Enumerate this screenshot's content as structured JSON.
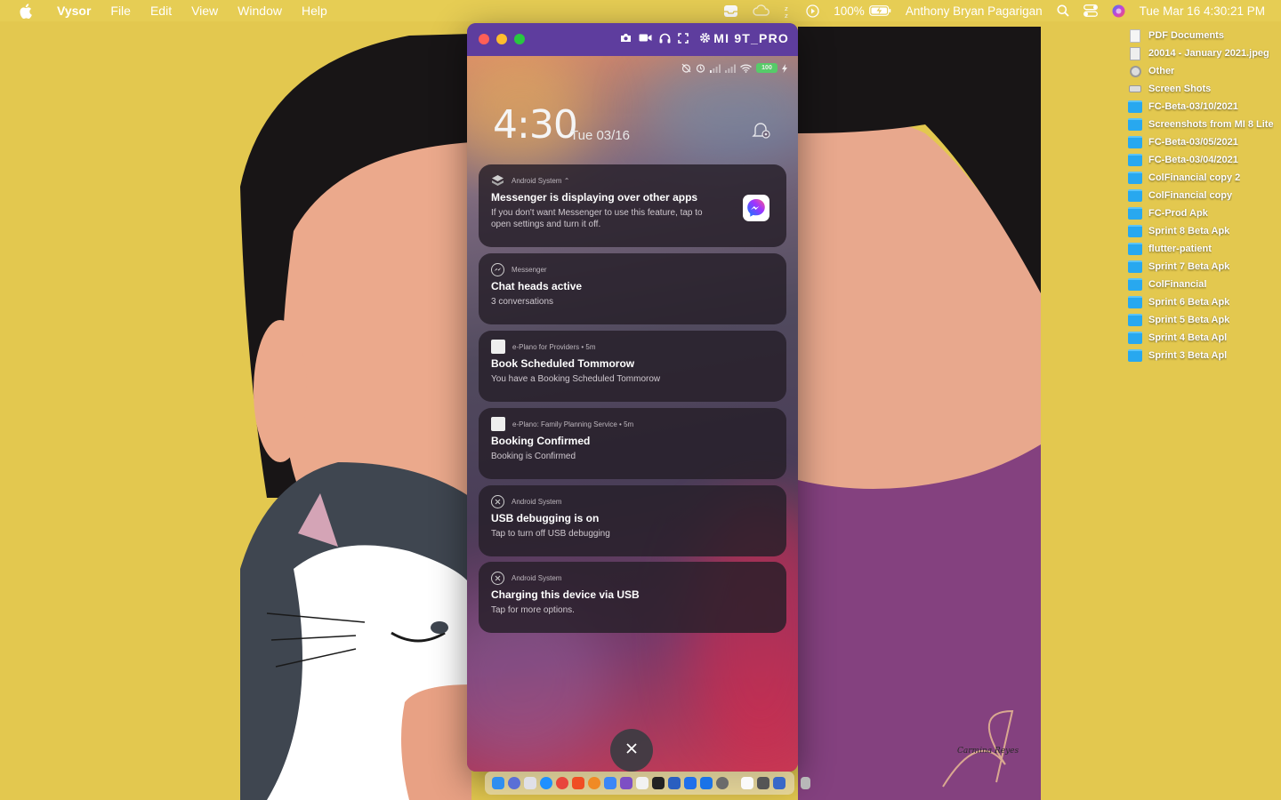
{
  "menubar": {
    "apple_icon": "apple-icon",
    "app_name": "Vysor",
    "menus": [
      "File",
      "Edit",
      "View",
      "Window",
      "Help"
    ],
    "battery_percent": "100%",
    "user_name": "Anthony Bryan Pagarigan",
    "datetime": "Tue Mar 16  4:30:21 PM"
  },
  "desktop": {
    "items": [
      {
        "label": "PDF Documents",
        "icon": "doc"
      },
      {
        "label": "20014 - January 2021.jpeg",
        "icon": "img"
      },
      {
        "label": "Other",
        "icon": "gear"
      },
      {
        "label": "Screen Shots",
        "icon": "drive"
      },
      {
        "label": "FC-Beta-03/10/2021",
        "icon": "folder"
      },
      {
        "label": "Screenshots from MI 8 Lite",
        "icon": "folder"
      },
      {
        "label": "FC-Beta-03/05/2021",
        "icon": "folder"
      },
      {
        "label": "FC-Beta-03/04/2021",
        "icon": "folder"
      },
      {
        "label": "ColFinancial copy 2",
        "icon": "folder"
      },
      {
        "label": "ColFinancial copy",
        "icon": "folder"
      },
      {
        "label": "FC-Prod Apk",
        "icon": "folder"
      },
      {
        "label": "Sprint 8 Beta Apk",
        "icon": "folder"
      },
      {
        "label": "flutter-patient",
        "icon": "folder"
      },
      {
        "label": "Sprint 7 Beta Apk",
        "icon": "folder"
      },
      {
        "label": "ColFinancial",
        "icon": "folder"
      },
      {
        "label": "Sprint 6 Beta Apk",
        "icon": "folder"
      },
      {
        "label": "Sprint 5 Beta Apk",
        "icon": "folder"
      },
      {
        "label": "Sprint 4 Beta Apl",
        "icon": "folder"
      },
      {
        "label": "Sprint 3 Beta Apl",
        "icon": "folder"
      }
    ]
  },
  "vysor": {
    "device_name": "MI 9T_PRO",
    "phone": {
      "battery": "100",
      "time": "4:30",
      "date": "Tue 03/16",
      "notifications": [
        {
          "app": "Android System ⌃",
          "title": "Messenger is displaying over other apps",
          "body": "If you don't want Messenger to use this feature, tap to open settings and turn it off."
        },
        {
          "app": "Messenger",
          "title": "Chat heads active",
          "body": "3 conversations"
        },
        {
          "app": "e-Plano for Providers • 5m",
          "title": "Book Scheduled Tommorow",
          "body": "You have a Booking Scheduled Tommorow"
        },
        {
          "app": "e-Plano: Family Planning Service • 5m",
          "title": "Booking Confirmed",
          "body": "Booking is Confirmed"
        },
        {
          "app": "Android System",
          "title": "USB debugging is on",
          "body": "Tap to turn off USB debugging"
        },
        {
          "app": "Android System",
          "title": "Charging this device via USB",
          "body": "Tap for more options."
        }
      ]
    }
  },
  "wallpaper": {
    "signature": "Carmina Reyes"
  },
  "colors": {
    "wallpaper_yellow": "#e3c84f",
    "vysor_purple": "#5e3d9e",
    "folder_blue": "#28a8ef"
  }
}
